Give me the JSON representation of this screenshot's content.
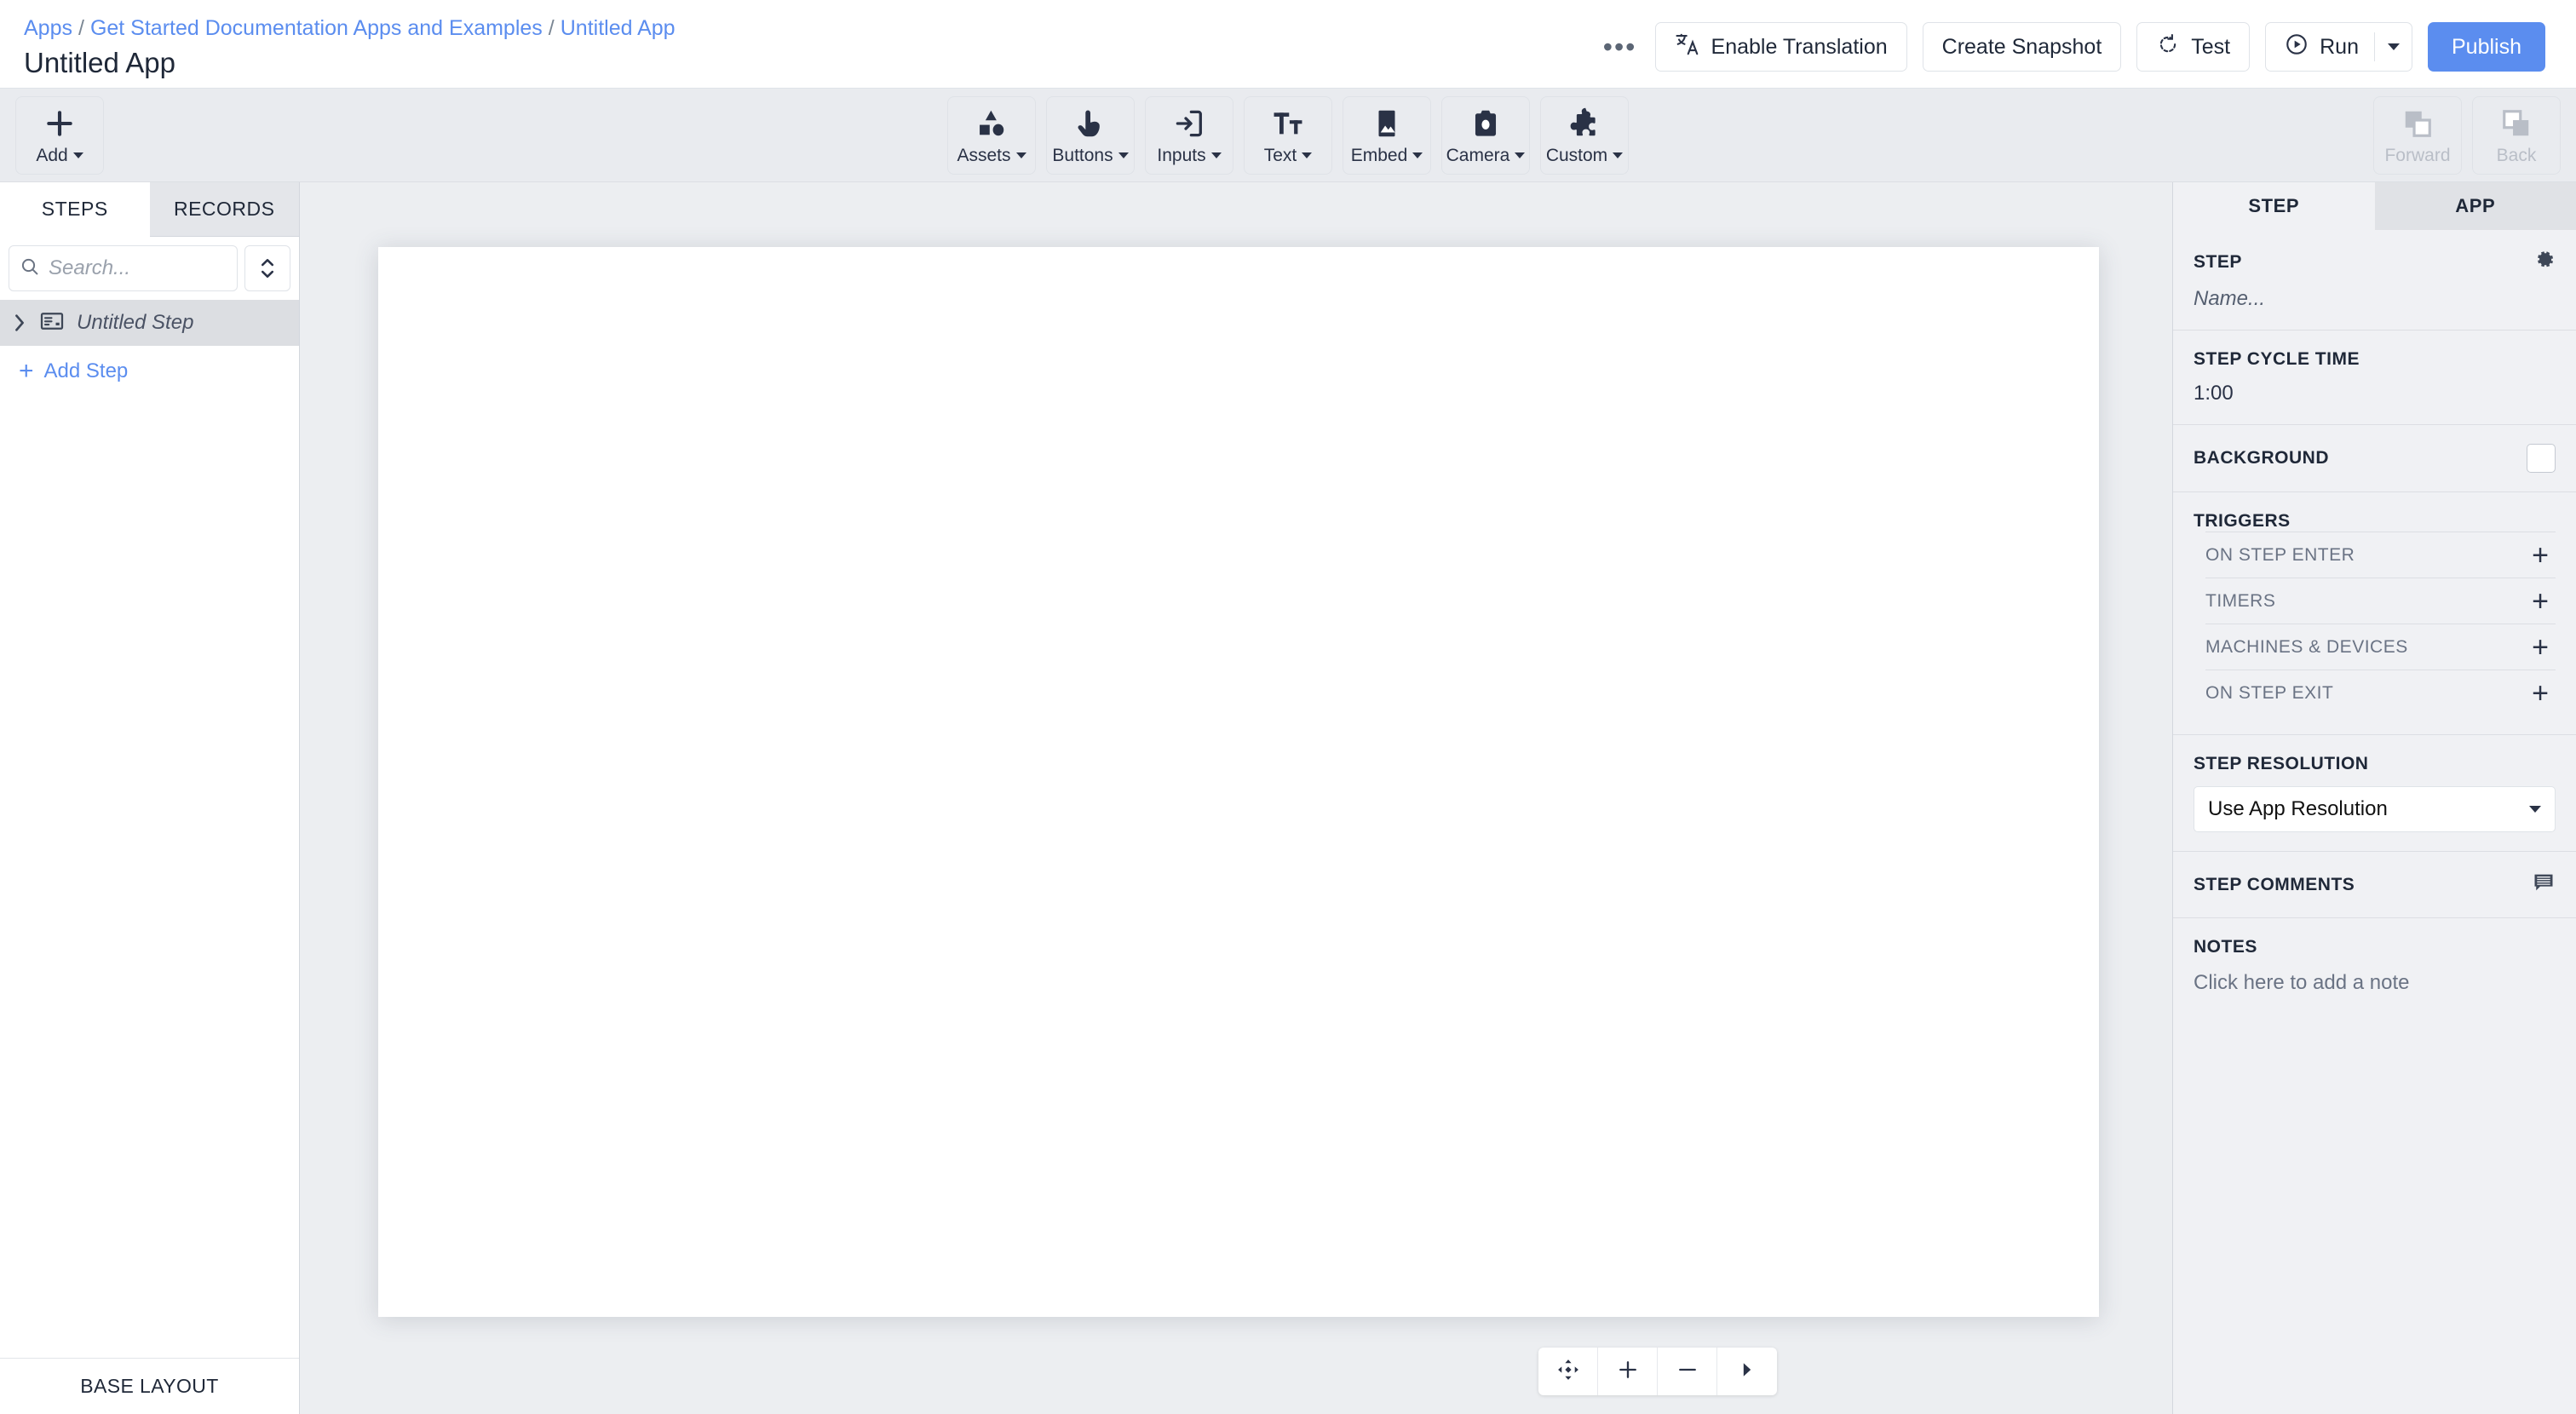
{
  "header": {
    "breadcrumb": [
      {
        "label": "Apps"
      },
      {
        "label": "Get Started Documentation Apps and Examples"
      },
      {
        "label": "Untitled App"
      }
    ],
    "separator": "/",
    "title": "Untitled App",
    "more_label": "•••",
    "buttons": {
      "enable_translation": "Enable Translation",
      "create_snapshot": "Create Snapshot",
      "test": "Test",
      "run": "Run",
      "publish": "Publish"
    },
    "accent_color": "#5b8def"
  },
  "toolbar": {
    "add": {
      "label": "Add",
      "icon": "plus-icon"
    },
    "items": [
      {
        "label": "Assets",
        "icon": "shapes-icon"
      },
      {
        "label": "Buttons",
        "icon": "pointing-hand-icon"
      },
      {
        "label": "Inputs",
        "icon": "login-arrow-icon"
      },
      {
        "label": "Text",
        "icon": "text-size-icon"
      },
      {
        "label": "Embed",
        "icon": "image-icon"
      },
      {
        "label": "Camera",
        "icon": "camera-icon"
      },
      {
        "label": "Custom",
        "icon": "puzzle-piece-icon"
      }
    ],
    "nav": [
      {
        "label": "Forward",
        "icon": "layer-forward-icon",
        "disabled": true
      },
      {
        "label": "Back",
        "icon": "layer-back-icon",
        "disabled": true
      }
    ]
  },
  "sidebar": {
    "tabs": [
      {
        "label": "STEPS",
        "active": true
      },
      {
        "label": "RECORDS",
        "active": false
      }
    ],
    "search": {
      "value": "",
      "placeholder": "Search..."
    },
    "sort_icon": "sort-updown-icon",
    "steps": [
      {
        "label": "Untitled Step",
        "icon": "step-card-icon",
        "expand_icon": "chevron-right-icon"
      }
    ],
    "add_step": "Add Step",
    "footer": "BASE LAYOUT"
  },
  "canvas": {
    "zoom_controls": [
      {
        "icon": "move-arrows-icon",
        "name": "pan-tool"
      },
      {
        "icon": "plus-icon",
        "name": "zoom-in"
      },
      {
        "icon": "minus-icon",
        "name": "zoom-out"
      },
      {
        "icon": "caret-right-icon",
        "name": "expand-controls"
      }
    ]
  },
  "right_panel": {
    "tabs": [
      {
        "label": "STEP",
        "active": true
      },
      {
        "label": "APP",
        "active": false
      }
    ],
    "step": {
      "title": "STEP",
      "gear_icon": "gear-icon",
      "name_placeholder": "Name..."
    },
    "cycle_time": {
      "title": "STEP CYCLE TIME",
      "value": "1:00"
    },
    "background": {
      "title": "BACKGROUND",
      "color": "#ffffff"
    },
    "triggers": {
      "title": "TRIGGERS",
      "rows": [
        {
          "label": "ON STEP ENTER",
          "add": "+"
        },
        {
          "label": "TIMERS",
          "add": "+"
        },
        {
          "label": "MACHINES & DEVICES",
          "add": "+"
        },
        {
          "label": "ON STEP EXIT",
          "add": "+"
        }
      ]
    },
    "resolution": {
      "title": "STEP RESOLUTION",
      "value": "Use App Resolution"
    },
    "comments": {
      "title": "STEP COMMENTS",
      "icon": "comment-icon"
    },
    "notes": {
      "title": "NOTES",
      "placeholder": "Click here to add a note"
    }
  }
}
